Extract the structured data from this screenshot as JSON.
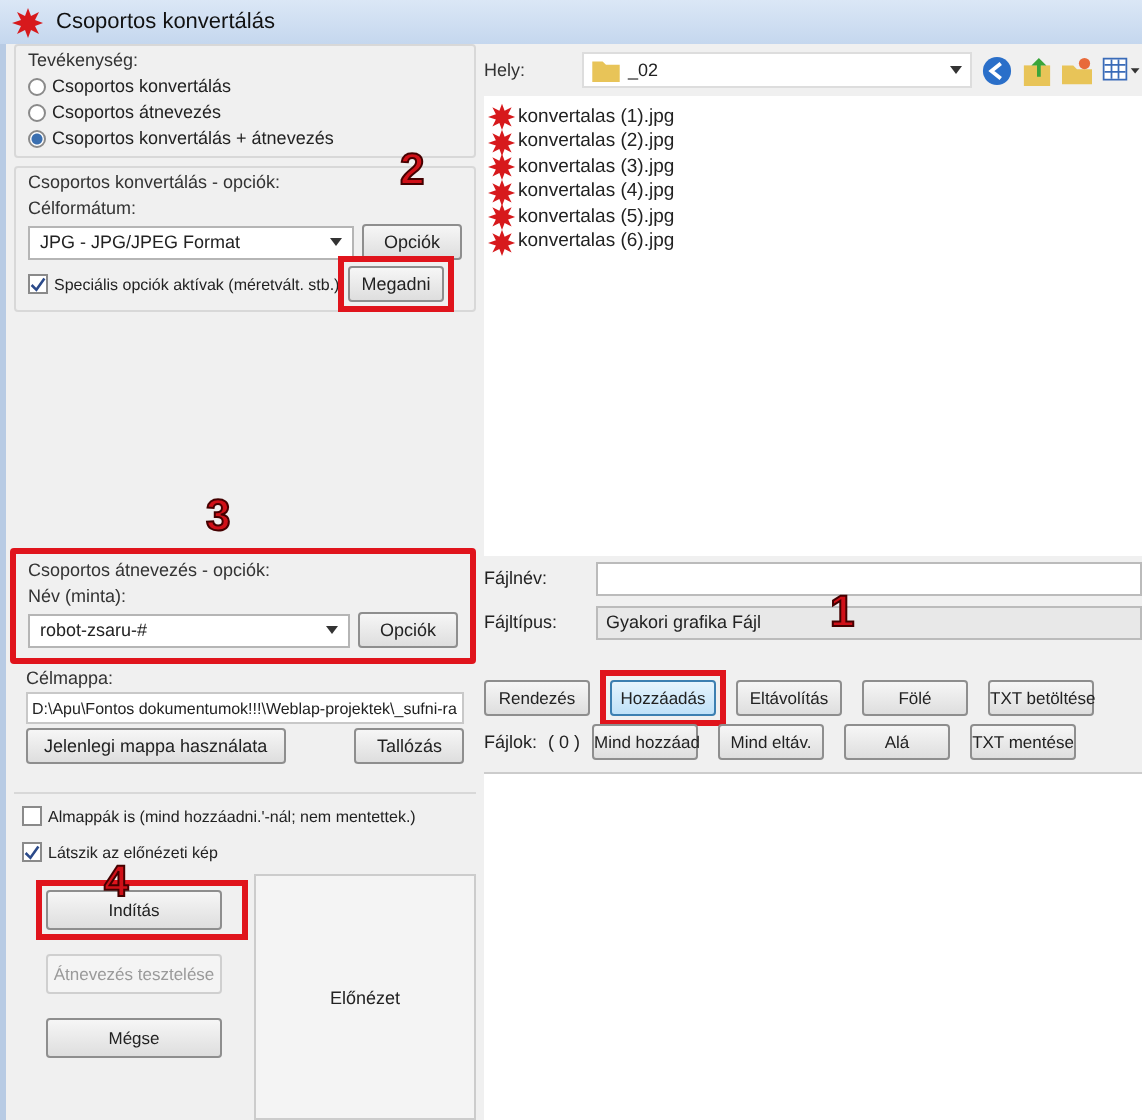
{
  "window": {
    "title": "Csoportos konvertálás"
  },
  "activity": {
    "title": "Tevékenység:",
    "options": [
      {
        "label": "Csoportos konvertálás",
        "selected": false
      },
      {
        "label": "Csoportos átnevezés",
        "selected": false
      },
      {
        "label": "Csoportos konvertálás + átnevezés",
        "selected": true
      }
    ]
  },
  "convert_options": {
    "title": "Csoportos konvertálás - opciók:",
    "format_label": "Célformátum:",
    "format": "JPG - JPG/JPEG Format",
    "options_button": "Opciók",
    "special": {
      "label": "Speciális opciók aktívak (méretvált. stb.)",
      "checked": true
    },
    "set_button": "Megadni"
  },
  "rename_options": {
    "title": "Csoportos átnevezés - opciók:",
    "name_label": "Név (minta):",
    "name": "robot-zsaru-#",
    "options_button": "Opciók"
  },
  "target": {
    "label": "Célmappa:",
    "path": "D:\\Apu\\Fontos dokumentumok!!!\\Weblap-projektek\\_sufni-ra",
    "current_button": "Jelenlegi mappa használata",
    "browse_button": "Tallózás"
  },
  "checkboxes": [
    {
      "label": "Almappák is (mind hozzáadni.'-nál; nem mentettek.)",
      "checked": false
    },
    {
      "label": "Látszik az előnézeti kép",
      "checked": true
    }
  ],
  "actions": [
    {
      "label": "Indítás",
      "disabled": false
    },
    {
      "label": "Átnevezés tesztelése",
      "disabled": true
    },
    {
      "label": "Mégse",
      "disabled": false
    }
  ],
  "preview": {
    "label": "Előnézet"
  },
  "browser": {
    "location_label": "Hely:",
    "folder": "_02",
    "files": [
      "konvertalas (1).jpg",
      "konvertalas (2).jpg",
      "konvertalas (3).jpg",
      "konvertalas (4).jpg",
      "konvertalas (5).jpg",
      "konvertalas (6).jpg"
    ],
    "filename_label": "Fájlnév:",
    "filetype_label": "Fájltípus:",
    "filetype": "Gyakori grafika Fájl"
  },
  "list_buttons": {
    "row1": [
      "Rendezés",
      "Hozzáadás",
      "Eltávolítás",
      "Fölé",
      "TXT betöltése"
    ],
    "files_label": "Fájlok:",
    "files_count": "( 0 )",
    "row2": [
      "Mind hozzáad",
      "Mind eltáv.",
      "Alá",
      "TXT mentése"
    ]
  },
  "annotations": [
    "2",
    "3",
    "1",
    "4"
  ]
}
